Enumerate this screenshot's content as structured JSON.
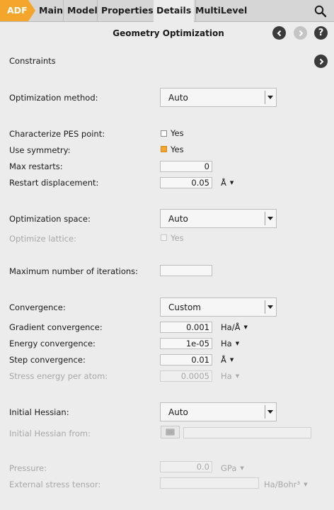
{
  "tabs": [
    "ADF",
    "Main",
    "Model",
    "Properties",
    "Details",
    "MultiLevel"
  ],
  "active_tab": "Details",
  "panel_title": "Geometry Optimization",
  "constraints_label": "Constraints",
  "optimization_method": {
    "label": "Optimization method:",
    "value": "Auto"
  },
  "characterize_pes": {
    "label": "Characterize PES point:",
    "checkbox_label": "Yes",
    "checked": false
  },
  "use_symmetry": {
    "label": "Use symmetry:",
    "checkbox_label": "Yes",
    "checked": true
  },
  "max_restarts": {
    "label": "Max restarts:",
    "value": "0"
  },
  "restart_displacement": {
    "label": "Restart displacement:",
    "value": "0.05",
    "unit": "Å"
  },
  "optimization_space": {
    "label": "Optimization space:",
    "value": "Auto"
  },
  "optimize_lattice": {
    "label": "Optimize lattice:",
    "checkbox_label": "Yes",
    "enabled": false
  },
  "max_iterations": {
    "label": "Maximum number of iterations:",
    "value": ""
  },
  "convergence": {
    "label": "Convergence:",
    "value": "Custom"
  },
  "gradient_convergence": {
    "label": "Gradient convergence:",
    "value": "0.001",
    "unit": "Ha/Å"
  },
  "energy_convergence": {
    "label": "Energy convergence:",
    "value": "1e-05",
    "unit": "Ha"
  },
  "step_convergence": {
    "label": "Step convergence:",
    "value": "0.01",
    "unit": "Å"
  },
  "stress_energy": {
    "label": "Stress energy per atom:",
    "value": "0.0005",
    "unit": "Ha"
  },
  "initial_hessian": {
    "label": "Initial Hessian:",
    "value": "Auto"
  },
  "initial_hessian_from": {
    "label": "Initial Hessian from:",
    "value": ""
  },
  "pressure": {
    "label": "Pressure:",
    "value": "0.0",
    "unit": "GPa"
  },
  "external_stress": {
    "label": "External stress tensor:",
    "value": "",
    "unit": "Ha/Bohr³"
  },
  "colors": {
    "accent": "#f4a52c",
    "background": "#ececec",
    "tabbar": "#d6d6d6"
  }
}
